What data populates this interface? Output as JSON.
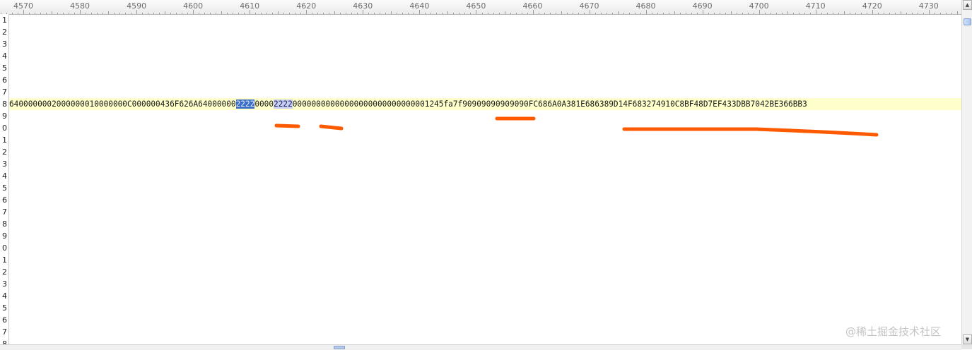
{
  "ruler": {
    "labels": [
      "4570",
      "4580",
      "4590",
      "4600",
      "4610",
      "4620",
      "4630",
      "4640",
      "4650",
      "4660",
      "4670",
      "4680",
      "4690",
      "4700",
      "4710",
      "4720",
      "4730"
    ]
  },
  "gutter": {
    "line_numbers": [
      "1",
      "2",
      "3",
      "4",
      "5",
      "6",
      "7",
      "8",
      "9",
      "0",
      "1",
      "2",
      "3",
      "4",
      "5",
      "6",
      "7",
      "8",
      "9",
      "0",
      "1",
      "2",
      "3",
      "4",
      "5",
      "6",
      "7",
      "8"
    ]
  },
  "editor": {
    "current_line": {
      "before": "6400000002000000010000000C000000436F626A64000000",
      "selected": "2222",
      "middle": "0000",
      "highlight": "2222",
      "after": "00000000000000000000000000001245fa7f90909090909090FC686A0A381E686389D14F683274910C8BF48D7EF433DBB7042BE366BB3"
    }
  },
  "annotation": {
    "color": "#ff5a00"
  },
  "watermark": "@稀土掘金技术社区"
}
